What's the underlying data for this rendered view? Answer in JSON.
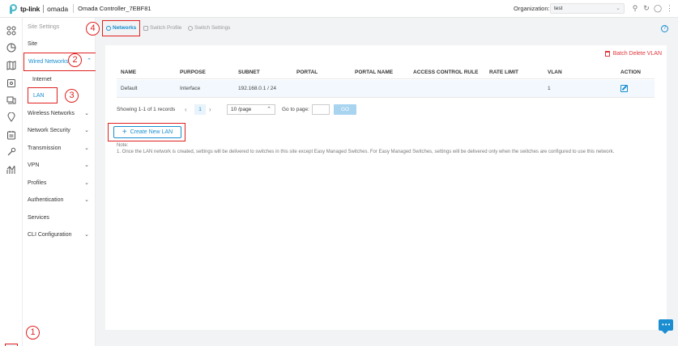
{
  "header": {
    "brand": "tp-link",
    "product": "omada",
    "controller_name": "Omada Controller_7EBF81",
    "organization_label": "Organization:",
    "organization_value": "test"
  },
  "rail": {
    "icons": [
      "dashboard-icon",
      "statistics-icon",
      "map-icon",
      "devices-icon",
      "clients-icon",
      "insight-icon",
      "logs-icon",
      "tools-icon",
      "reports-icon",
      "settings-icon"
    ]
  },
  "sidebar": {
    "heading": "Site Settings",
    "items": [
      {
        "label": "Site"
      },
      {
        "label": "Wired Networks"
      },
      {
        "label": "Internet"
      },
      {
        "label": "LAN"
      },
      {
        "label": "Wireless Networks"
      },
      {
        "label": "Network Security"
      },
      {
        "label": "Transmission"
      },
      {
        "label": "VPN"
      },
      {
        "label": "Profiles"
      },
      {
        "label": "Authentication"
      },
      {
        "label": "Services"
      },
      {
        "label": "CLI Configuration"
      }
    ]
  },
  "tabs": [
    {
      "label": "Networks",
      "active": true
    },
    {
      "label": "Switch Profile",
      "active": false
    },
    {
      "label": "Switch Settings",
      "active": false
    }
  ],
  "actions": {
    "batch_delete": "Batch Delete VLAN",
    "create_lan": "Create New LAN"
  },
  "table": {
    "columns": [
      "NAME",
      "PURPOSE",
      "SUBNET",
      "PORTAL",
      "PORTAL NAME",
      "ACCESS CONTROL RULE",
      "RATE LIMIT",
      "VLAN",
      "ACTION"
    ],
    "rows": [
      {
        "name": "Default",
        "purpose": "Interface",
        "subnet": "192.168.0.1 / 24",
        "portal": "",
        "portal_name": "",
        "acl": "",
        "rate_limit": "",
        "vlan": "1"
      }
    ]
  },
  "pagination": {
    "summary": "Showing 1-1 of 1 records",
    "current_page": "1",
    "page_size": "10 /page",
    "goto_label": "Go to page:",
    "go_button": "GO"
  },
  "note": {
    "title": "Note:",
    "text": "1. Once the LAN network is created, settings will be delivered to switches in this site except Easy Managed Switches. For Easy Managed Switches, settings will be delivered only when the switches are configured to use this network."
  },
  "annotations": [
    "1",
    "2",
    "3",
    "4"
  ],
  "colors": {
    "accent": "#1a8ed0",
    "highlight": "#e02020",
    "danger": "#e0353b",
    "background": "#f2f3f5"
  }
}
